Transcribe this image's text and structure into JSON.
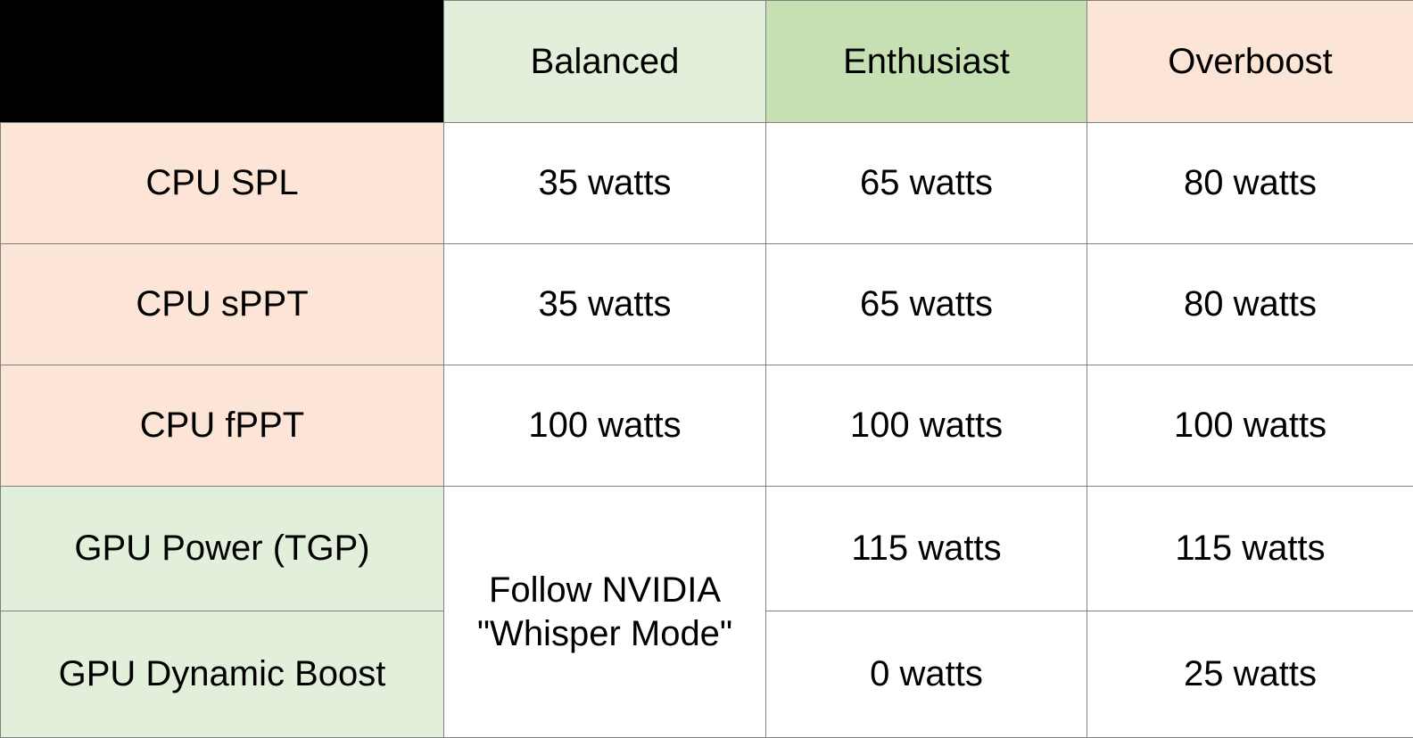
{
  "table": {
    "corner_label": "",
    "columns": [
      {
        "key": "label",
        "label": "",
        "header_bg": "#000000"
      },
      {
        "key": "bal",
        "label": "Balanced",
        "header_bg": "#e2efda"
      },
      {
        "key": "ent",
        "label": "Enthusiast",
        "header_bg": "#c6e0b4"
      },
      {
        "key": "ovr",
        "label": "Overboost",
        "header_bg": "#fce4d6"
      }
    ],
    "rows": [
      {
        "label": "CPU SPL",
        "label_bg": "#fce4d6",
        "balanced": "35 watts",
        "enthusiast": "65 watts",
        "overboost": "80 watts"
      },
      {
        "label": "CPU sPPT",
        "label_bg": "#fce4d6",
        "balanced": "35 watts",
        "enthusiast": "65 watts",
        "overboost": "80 watts"
      },
      {
        "label": "CPU fPPT",
        "label_bg": "#fce4d6",
        "balanced": "100 watts",
        "enthusiast": "100 watts",
        "overboost": "100 watts"
      },
      {
        "label": "GPU Power (TGP)",
        "label_bg": "#e2efda",
        "balanced": "",
        "enthusiast": "115 watts",
        "overboost": "115 watts"
      },
      {
        "label": "GPU Dynamic Boost",
        "label_bg": "#e2efda",
        "balanced": "",
        "enthusiast": "0 watts",
        "overboost": "25 watts"
      }
    ],
    "merged_balanced_note": "Follow NVIDIA\n\"Whisper Mode\"",
    "colors": {
      "corner": "#000000",
      "green_light": "#e2efda",
      "green_mid": "#c6e0b4",
      "peach": "#fce4d6",
      "white": "#ffffff",
      "border": "#808080",
      "text": "#000000"
    }
  }
}
